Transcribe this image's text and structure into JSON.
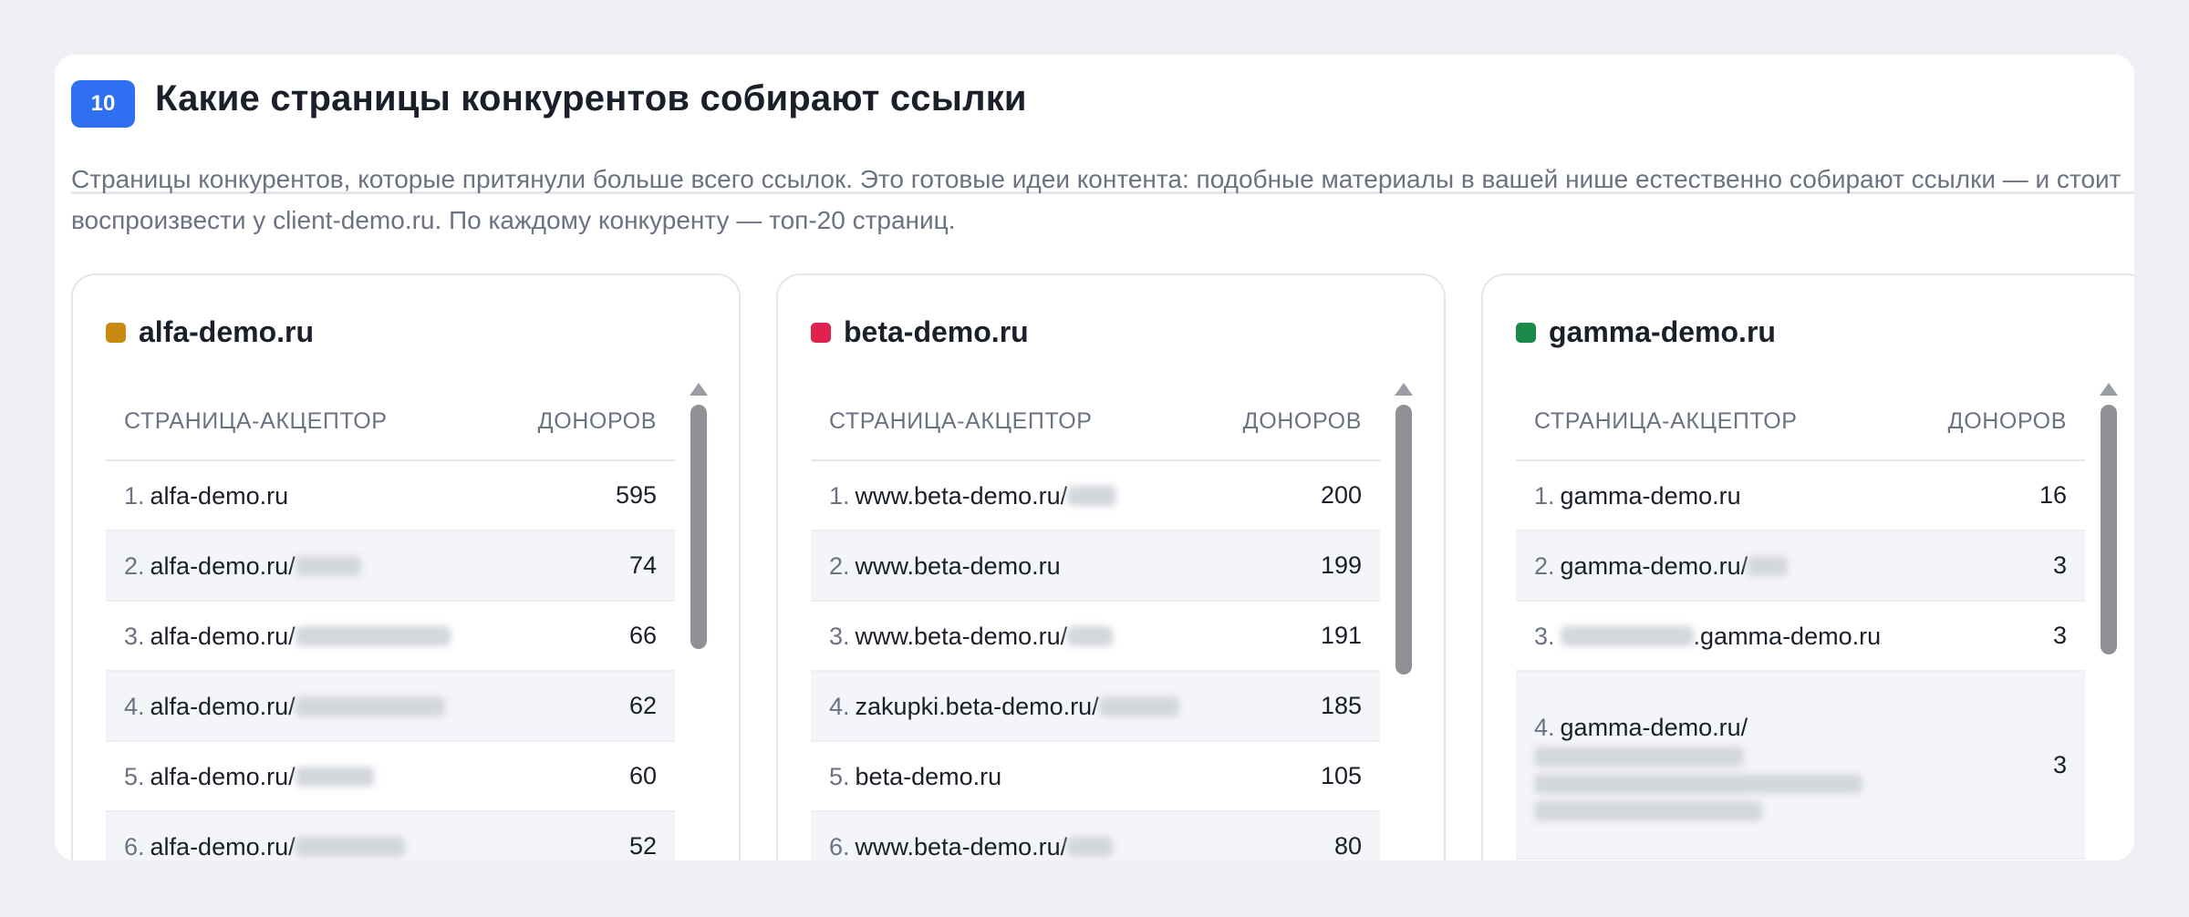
{
  "section": {
    "number": "10",
    "title": "Какие страницы конкурентов собирают ссылки",
    "description": "Страницы конкурентов, которые притянули больше всего ссылок. Это готовые идеи контента: подобные материалы в вашей нише естественно собирают ссылки — и стоит воспроизвести у client-demo.ru. По каждому конкуренту — топ-20 страниц."
  },
  "table_headers": {
    "page": "СТРАНИЦА-АКЦЕПТОР",
    "donors": "ДОНОРОВ"
  },
  "competitors": [
    {
      "name": "alfa-demo.ru",
      "color": "#c98a12",
      "rows": [
        {
          "n": "1.",
          "page": "alfa-demo.ru",
          "donors": "595"
        },
        {
          "n": "2.",
          "page": "alfa-demo.ru/",
          "donors": "74"
        },
        {
          "n": "3.",
          "page": "alfa-demo.ru/",
          "donors": "66"
        },
        {
          "n": "4.",
          "page": "alfa-demo.ru/",
          "donors": "62"
        },
        {
          "n": "5.",
          "page": "alfa-demo.ru/",
          "donors": "60"
        },
        {
          "n": "6.",
          "page": "alfa-demo.ru/",
          "donors": "52"
        }
      ]
    },
    {
      "name": "beta-demo.ru",
      "color": "#e0234e",
      "rows": [
        {
          "n": "1.",
          "page": "www.beta-demo.ru/",
          "donors": "200"
        },
        {
          "n": "2.",
          "page": "www.beta-demo.ru",
          "donors": "199"
        },
        {
          "n": "3.",
          "page": "www.beta-demo.ru/",
          "donors": "191"
        },
        {
          "n": "4.",
          "page": "zakupki.beta-demo.ru/",
          "donors": "185"
        },
        {
          "n": "5.",
          "page": "beta-demo.ru",
          "donors": "105"
        },
        {
          "n": "6.",
          "page": "www.beta-demo.ru/",
          "donors": "80"
        }
      ]
    },
    {
      "name": "gamma-demo.ru",
      "color": "#1a8a4a",
      "rows": [
        {
          "n": "1.",
          "page": "gamma-demo.ru",
          "donors": "16"
        },
        {
          "n": "2.",
          "page": "gamma-demo.ru/",
          "donors": "3"
        },
        {
          "n": "3.",
          "page": ".gamma-demo.ru",
          "donors": "3"
        },
        {
          "n": "4.",
          "page": "gamma-demo.ru/",
          "donors": "3"
        }
      ]
    }
  ]
}
